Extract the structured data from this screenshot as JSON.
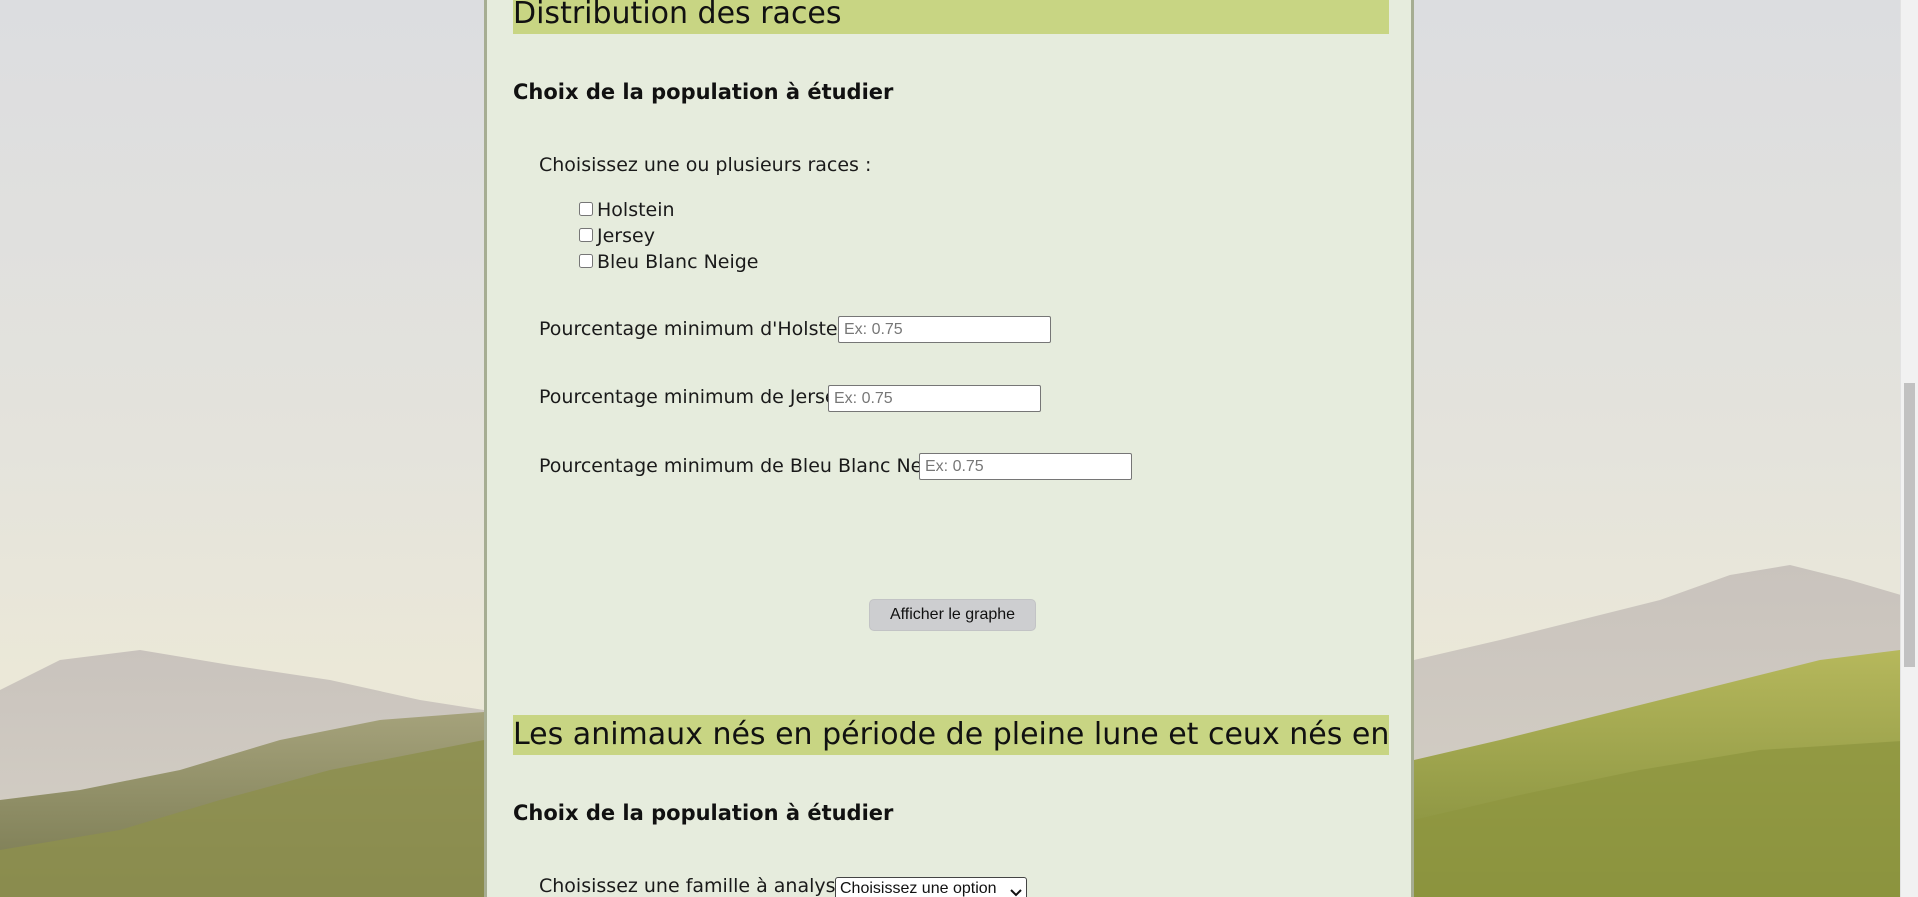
{
  "section1": {
    "title": "Distribution des races",
    "subtitle": "Choix de la population à étudier",
    "races_prompt": "Choisissez une ou plusieurs races :",
    "races": [
      {
        "label": "Holstein",
        "checked": false
      },
      {
        "label": "Jersey",
        "checked": false
      },
      {
        "label": "Bleu Blanc Neige",
        "checked": false
      }
    ],
    "pct_holstein_label": "Pourcentage minimum d'Holstein :",
    "pct_jersey_label": "Pourcentage minimum de Jersey :",
    "pct_bbn_label": "Pourcentage minimum de Bleu Blanc Neige:",
    "pct_placeholder": "Ex: 0.75",
    "button_label": "Afficher le graphe"
  },
  "section2": {
    "title": "Les animaux nés en période de pleine lune et ceux nés en dehors",
    "subtitle": "Choix de la population à étudier",
    "family_label": "Choisissez une famille à analyser :",
    "family_selected": "Choisissez une option"
  },
  "colors": {
    "panel_bg": "#e6ecdd",
    "heading_bg": "#c8d583",
    "button_bg": "#cdced0"
  }
}
